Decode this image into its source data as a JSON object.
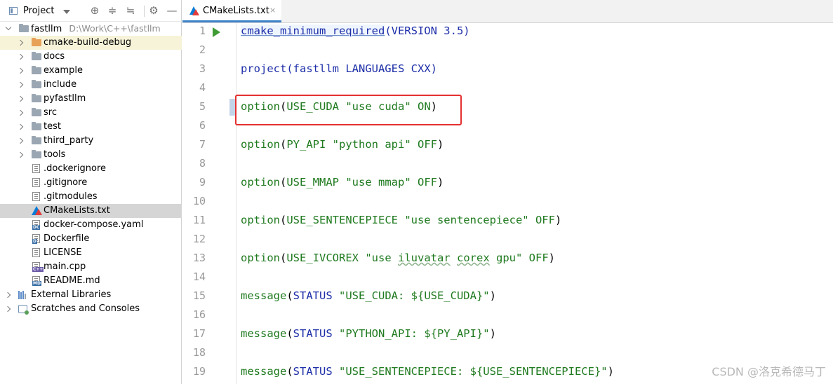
{
  "project_panel": {
    "title": "Project",
    "tree": [
      {
        "label": "fastllm",
        "path": "D:\\Work\\C++\\fastllm",
        "type": "folder"
      },
      {
        "label": "cmake-build-debug",
        "type": "folder-orange"
      },
      {
        "label": "docs",
        "type": "folder"
      },
      {
        "label": "example",
        "type": "folder"
      },
      {
        "label": "include",
        "type": "folder"
      },
      {
        "label": "pyfastllm",
        "type": "folder"
      },
      {
        "label": "src",
        "type": "folder"
      },
      {
        "label": "test",
        "type": "folder"
      },
      {
        "label": "third_party",
        "type": "folder"
      },
      {
        "label": "tools",
        "type": "folder"
      },
      {
        "label": ".dockerignore",
        "type": "file"
      },
      {
        "label": ".gitignore",
        "type": "file"
      },
      {
        "label": ".gitmodules",
        "type": "file"
      },
      {
        "label": "CMakeLists.txt",
        "type": "cmake",
        "selected": true
      },
      {
        "label": "docker-compose.yaml",
        "type": "file-dc"
      },
      {
        "label": "Dockerfile",
        "type": "file-d"
      },
      {
        "label": "LICENSE",
        "type": "file"
      },
      {
        "label": "main.cpp",
        "type": "file-cpp"
      },
      {
        "label": "README.md",
        "type": "file-md"
      },
      {
        "label": "External Libraries",
        "type": "libraries"
      },
      {
        "label": "Scratches and Consoles",
        "type": "scratches"
      }
    ]
  },
  "editor": {
    "active_tab": "CMakeLists.txt",
    "tab_close": "×",
    "line_numbers": [
      "1",
      "2",
      "3",
      "4",
      "5",
      "6",
      "7",
      "8",
      "9",
      "10",
      "11",
      "12",
      "13",
      "14",
      "15",
      "16",
      "17",
      "18",
      "19"
    ],
    "code": {
      "l1_fn": "cmake_minimum_required",
      "l1_args": "(VERSION 3.5)",
      "l3_fn": "project",
      "l3_args": "(fastllm LANGUAGES CXX)",
      "l5_fn": "option",
      "l5_open": "(",
      "l5_name": "USE_CUDA",
      "l5_str": " \"use cuda\" ",
      "l5_val": "ON",
      "l5_close": ")",
      "l7_fn": "option",
      "l7_open": "(",
      "l7_name": "PY_API",
      "l7_str": " \"python api\" ",
      "l7_val": "OFF",
      "l7_close": ")",
      "l9_fn": "option",
      "l9_open": "(",
      "l9_name": "USE_MMAP",
      "l9_str": " \"use mmap\" ",
      "l9_val": "OFF",
      "l9_close": ")",
      "l11_fn": "option",
      "l11_open": "(",
      "l11_name": "USE_SENTENCEPIECE",
      "l11_str": " \"use sentencepiece\" ",
      "l11_val": "OFF",
      "l11_close": ")",
      "l13_fn": "option",
      "l13_open": "(",
      "l13_name": "USE_IVCOREX",
      "l13_str_a": " \"use ",
      "l13_str_b": "iluvatar",
      "l13_str_c": " ",
      "l13_str_d": "corex",
      "l13_str_e": " gpu\" ",
      "l13_val": "OFF",
      "l13_close": ")",
      "l15_fn": "message",
      "l15_open": "(",
      "l15_kw": "STATUS",
      "l15_str": " \"USE_CUDA: ${USE_CUDA}\"",
      "l15_close": ")",
      "l17_fn": "message",
      "l17_open": "(",
      "l17_kw": "STATUS",
      "l17_str": " \"PYTHON_API: ${PY_API}\"",
      "l17_close": ")",
      "l19_fn": "message",
      "l19_open": "(",
      "l19_kw": "STATUS",
      "l19_str": " \"USE_SENTENCEPIECE: ${USE_SENTENCEPIECE}\"",
      "l19_close": ")"
    }
  },
  "watermark": "CSDN @洛克希德马丁",
  "colors": {
    "keyword": "#1d2ea8",
    "string": "#1f7a1f",
    "highlight_box": "#e53030",
    "selection": "#d5d5d5",
    "tab_underline": "#4083c9"
  }
}
